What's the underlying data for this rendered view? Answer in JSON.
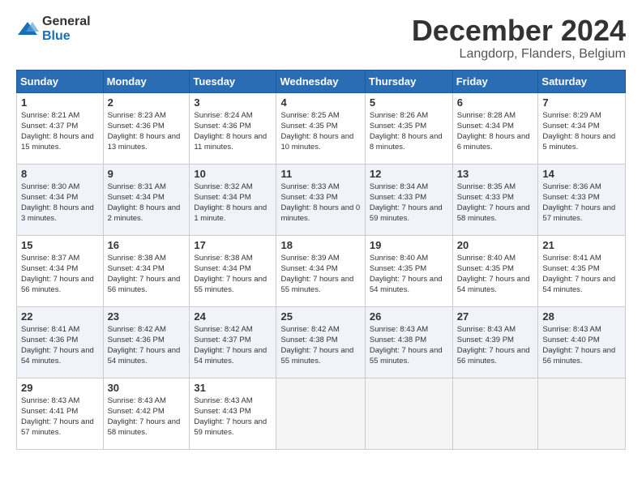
{
  "logo": {
    "general": "General",
    "blue": "Blue"
  },
  "header": {
    "month": "December 2024",
    "location": "Langdorp, Flanders, Belgium"
  },
  "days_of_week": [
    "Sunday",
    "Monday",
    "Tuesday",
    "Wednesday",
    "Thursday",
    "Friday",
    "Saturday"
  ],
  "weeks": [
    [
      {
        "day": "1",
        "sunrise": "8:21 AM",
        "sunset": "4:37 PM",
        "daylight": "8 hours and 15 minutes."
      },
      {
        "day": "2",
        "sunrise": "8:23 AM",
        "sunset": "4:36 PM",
        "daylight": "8 hours and 13 minutes."
      },
      {
        "day": "3",
        "sunrise": "8:24 AM",
        "sunset": "4:36 PM",
        "daylight": "8 hours and 11 minutes."
      },
      {
        "day": "4",
        "sunrise": "8:25 AM",
        "sunset": "4:35 PM",
        "daylight": "8 hours and 10 minutes."
      },
      {
        "day": "5",
        "sunrise": "8:26 AM",
        "sunset": "4:35 PM",
        "daylight": "8 hours and 8 minutes."
      },
      {
        "day": "6",
        "sunrise": "8:28 AM",
        "sunset": "4:34 PM",
        "daylight": "8 hours and 6 minutes."
      },
      {
        "day": "7",
        "sunrise": "8:29 AM",
        "sunset": "4:34 PM",
        "daylight": "8 hours and 5 minutes."
      }
    ],
    [
      {
        "day": "8",
        "sunrise": "8:30 AM",
        "sunset": "4:34 PM",
        "daylight": "8 hours and 3 minutes."
      },
      {
        "day": "9",
        "sunrise": "8:31 AM",
        "sunset": "4:34 PM",
        "daylight": "8 hours and 2 minutes."
      },
      {
        "day": "10",
        "sunrise": "8:32 AM",
        "sunset": "4:34 PM",
        "daylight": "8 hours and 1 minute."
      },
      {
        "day": "11",
        "sunrise": "8:33 AM",
        "sunset": "4:33 PM",
        "daylight": "8 hours and 0 minutes."
      },
      {
        "day": "12",
        "sunrise": "8:34 AM",
        "sunset": "4:33 PM",
        "daylight": "7 hours and 59 minutes."
      },
      {
        "day": "13",
        "sunrise": "8:35 AM",
        "sunset": "4:33 PM",
        "daylight": "7 hours and 58 minutes."
      },
      {
        "day": "14",
        "sunrise": "8:36 AM",
        "sunset": "4:33 PM",
        "daylight": "7 hours and 57 minutes."
      }
    ],
    [
      {
        "day": "15",
        "sunrise": "8:37 AM",
        "sunset": "4:34 PM",
        "daylight": "7 hours and 56 minutes."
      },
      {
        "day": "16",
        "sunrise": "8:38 AM",
        "sunset": "4:34 PM",
        "daylight": "7 hours and 56 minutes."
      },
      {
        "day": "17",
        "sunrise": "8:38 AM",
        "sunset": "4:34 PM",
        "daylight": "7 hours and 55 minutes."
      },
      {
        "day": "18",
        "sunrise": "8:39 AM",
        "sunset": "4:34 PM",
        "daylight": "7 hours and 55 minutes."
      },
      {
        "day": "19",
        "sunrise": "8:40 AM",
        "sunset": "4:35 PM",
        "daylight": "7 hours and 54 minutes."
      },
      {
        "day": "20",
        "sunrise": "8:40 AM",
        "sunset": "4:35 PM",
        "daylight": "7 hours and 54 minutes."
      },
      {
        "day": "21",
        "sunrise": "8:41 AM",
        "sunset": "4:35 PM",
        "daylight": "7 hours and 54 minutes."
      }
    ],
    [
      {
        "day": "22",
        "sunrise": "8:41 AM",
        "sunset": "4:36 PM",
        "daylight": "7 hours and 54 minutes."
      },
      {
        "day": "23",
        "sunrise": "8:42 AM",
        "sunset": "4:36 PM",
        "daylight": "7 hours and 54 minutes."
      },
      {
        "day": "24",
        "sunrise": "8:42 AM",
        "sunset": "4:37 PM",
        "daylight": "7 hours and 54 minutes."
      },
      {
        "day": "25",
        "sunrise": "8:42 AM",
        "sunset": "4:38 PM",
        "daylight": "7 hours and 55 minutes."
      },
      {
        "day": "26",
        "sunrise": "8:43 AM",
        "sunset": "4:38 PM",
        "daylight": "7 hours and 55 minutes."
      },
      {
        "day": "27",
        "sunrise": "8:43 AM",
        "sunset": "4:39 PM",
        "daylight": "7 hours and 56 minutes."
      },
      {
        "day": "28",
        "sunrise": "8:43 AM",
        "sunset": "4:40 PM",
        "daylight": "7 hours and 56 minutes."
      }
    ],
    [
      {
        "day": "29",
        "sunrise": "8:43 AM",
        "sunset": "4:41 PM",
        "daylight": "7 hours and 57 minutes."
      },
      {
        "day": "30",
        "sunrise": "8:43 AM",
        "sunset": "4:42 PM",
        "daylight": "7 hours and 58 minutes."
      },
      {
        "day": "31",
        "sunrise": "8:43 AM",
        "sunset": "4:43 PM",
        "daylight": "7 hours and 59 minutes."
      },
      null,
      null,
      null,
      null
    ]
  ]
}
